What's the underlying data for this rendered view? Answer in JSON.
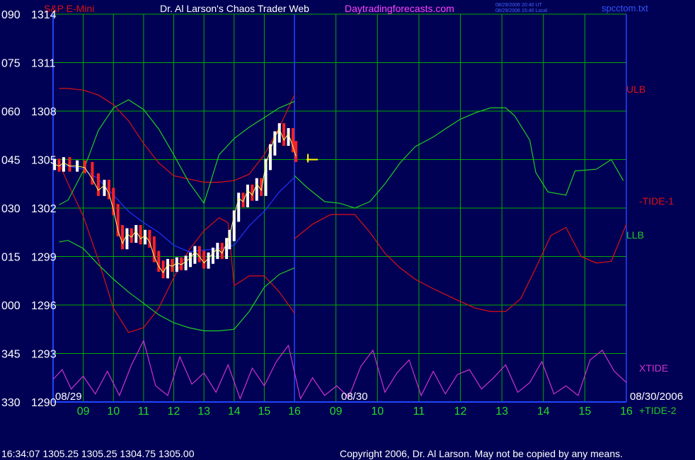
{
  "header": {
    "instrument": "S&P E-Mini",
    "title": "Dr. Al Larson's Chaos Trader Web",
    "site": "Daytradingforecasts.com",
    "stamp_ut": "08/29/2006 20:40 UT",
    "stamp_local": "08/29/2006 15:40 Local",
    "file": "spcctom.txt"
  },
  "footer": {
    "quote": "16:34:07  1305.25 1305.25 1304.75 1305.00",
    "copyright": "Copyright 2006, Dr. Al Larson. May not be copied by any means."
  },
  "colors": {
    "background": "#000055",
    "grid": "#00aa00",
    "axis": "#2244ff",
    "ulb_llb_tide1": "#dd1111",
    "llb_green": "#22cc22",
    "xtide": "#cc33cc",
    "avg_blue": "#2233ff",
    "price_bar_up": "#ffffff",
    "price_bar_down": "#ff2222",
    "title_text": "#ffffff",
    "site_text": "#ff44ff",
    "tick_text": "#22dd22"
  },
  "chart_data": {
    "type": "line",
    "y_left_labels": [
      "090",
      "075",
      "060",
      "045",
      "030",
      "015",
      "000",
      "345",
      "330"
    ],
    "y_right_labels": [
      "1314",
      "1311",
      "1308",
      "1305",
      "1302",
      "1299",
      "1296",
      "1293",
      "1290"
    ],
    "ylim": [
      1290,
      1314
    ],
    "x_tick_labels": [
      "09",
      "10",
      "11",
      "12",
      "13",
      "14",
      "15",
      "16",
      "09",
      "10",
      "11",
      "12",
      "13",
      "14",
      "15",
      "16"
    ],
    "date_labels": [
      "08/29",
      "08/30",
      "08/30/2006"
    ],
    "series_labels": [
      "ULB",
      "-TIDE-1",
      "LLB",
      "XTIDE",
      "+TIDE-2"
    ],
    "series": [
      {
        "key": "red_upper",
        "color": "#dd1111",
        "hours": [
          8.2,
          8.5,
          9,
          9.5,
          10,
          10.5,
          11,
          11.5,
          12,
          12.5,
          13,
          13.5,
          14,
          14.5,
          15,
          15.5,
          16
        ],
        "values": [
          1309.4,
          1309.4,
          1309.3,
          1309.0,
          1308.4,
          1307.4,
          1306.0,
          1304.8,
          1304.0,
          1303.8,
          1303.6,
          1303.6,
          1303.7,
          1304.1,
          1305.3,
          1307.0,
          1309.0
        ]
      },
      {
        "key": "red_lower",
        "color": "#dd1111",
        "hours": [
          8.2,
          8.5,
          9,
          9.5,
          10,
          10.5,
          11,
          11.5,
          12,
          12.5,
          13,
          13.5,
          13.8,
          14,
          14.5,
          15,
          15.5,
          16
        ],
        "values": [
          1304.8,
          1303.5,
          1301.5,
          1298.8,
          1295.8,
          1294.3,
          1294.6,
          1295.8,
          1297.7,
          1299.4,
          1300.6,
          1301.4,
          1301.1,
          1297.2,
          1297.8,
          1297.8,
          1296.8,
          1295.5
        ]
      },
      {
        "key": "green_upper",
        "color": "#22cc22",
        "hours": [
          8.2,
          8.5,
          9,
          9.5,
          10,
          10.5,
          11,
          11.5,
          12,
          12.5,
          13,
          13.5,
          14,
          14.5,
          15,
          15.5,
          16
        ],
        "values": [
          1302.2,
          1302.5,
          1304.3,
          1306.8,
          1308.2,
          1308.7,
          1308.1,
          1306.9,
          1305.3,
          1303.6,
          1302.3,
          1305.3,
          1306.3,
          1307.0,
          1307.6,
          1308.2,
          1308.6
        ]
      },
      {
        "key": "green_lower",
        "color": "#22cc22",
        "hours": [
          8.2,
          8.5,
          9,
          9.5,
          10,
          10.5,
          11,
          11.5,
          12,
          12.5,
          13,
          13.5,
          14,
          14.5,
          15,
          15.5,
          16
        ],
        "values": [
          1299.9,
          1300.0,
          1299.5,
          1298.5,
          1297.6,
          1296.8,
          1296.1,
          1295.4,
          1294.9,
          1294.6,
          1294.4,
          1294.4,
          1294.5,
          1295.6,
          1297.1,
          1297.9,
          1298.3
        ]
      },
      {
        "key": "blue_avg",
        "color": "#2233ff",
        "hours": [
          8.2,
          8.5,
          9,
          9.5,
          10,
          10.5,
          11,
          11.5,
          12,
          12.5,
          13,
          13.5,
          14,
          14.5,
          15,
          15.5,
          16
        ],
        "values": [
          1304.6,
          1304.6,
          1304.4,
          1303.8,
          1302.8,
          1301.8,
          1301.1,
          1300.5,
          1299.7,
          1299.3,
          1299.4,
          1299.5,
          1299.7,
          1300.9,
          1301.8,
          1303.0,
          1303.9
        ]
      },
      {
        "key": "tide1_forecast",
        "color": "#dd1111",
        "hours": [
          16,
          16.6,
          17.2,
          18,
          18.5,
          19,
          19.5,
          20,
          20.5,
          21.4,
          22,
          22.5,
          23,
          23.5,
          24,
          24.5,
          25,
          25.5,
          26,
          26.5,
          27
        ],
        "values": [
          1300.1,
          1301.0,
          1301.6,
          1301.6,
          1300.5,
          1299.2,
          1298.3,
          1297.6,
          1297.1,
          1296.3,
          1295.8,
          1295.6,
          1295.6,
          1296.4,
          1298.3,
          1300.3,
          1300.8,
          1299.0,
          1298.6,
          1298.7,
          1301.0
        ]
      },
      {
        "key": "tide2_forecast",
        "color": "#22cc22",
        "hours": [
          16,
          16.4,
          17,
          17.5,
          18,
          18.5,
          19,
          19.5,
          20,
          20.6,
          21,
          21.5,
          22,
          22.5,
          23,
          23.3,
          23.8,
          24,
          24.4,
          25,
          25.3,
          26,
          26.5,
          26.9
        ],
        "values": [
          1304.0,
          1303.3,
          1302.4,
          1302.3,
          1302.0,
          1302.4,
          1303.5,
          1304.8,
          1305.8,
          1306.4,
          1306.9,
          1307.5,
          1307.9,
          1308.2,
          1308.2,
          1307.7,
          1306.2,
          1304.2,
          1303.0,
          1302.8,
          1304.3,
          1304.4,
          1305.0,
          1303.7
        ]
      },
      {
        "key": "xtide",
        "color": "#cc33cc",
        "hours": [
          8,
          8.3,
          8.6,
          9.0,
          9.4,
          9.8,
          10.2,
          10.6,
          11.0,
          11.4,
          11.8,
          12.2,
          12.6,
          13.0,
          13.4,
          13.8,
          14.2,
          14.6,
          15.0,
          15.4,
          15.8,
          16.2,
          16.6,
          17.0,
          17.4,
          17.8,
          18.2,
          18.6,
          19.0,
          19.4,
          19.8,
          20.2,
          20.6,
          21.0,
          21.4,
          21.8,
          22.2,
          22.6,
          23.0,
          23.4,
          23.8,
          24.2,
          24.6,
          25.0,
          25.4,
          25.8,
          26.2,
          26.6,
          27.0
        ],
        "values": [
          1291.4,
          1292.0,
          1290.8,
          1291.6,
          1290.5,
          1291.9,
          1290.4,
          1292.3,
          1293.8,
          1291.0,
          1290.4,
          1292.8,
          1291.1,
          1291.8,
          1290.6,
          1292.3,
          1290.2,
          1292.1,
          1291.0,
          1292.5,
          1293.5,
          1290.2,
          1291.5,
          1290.4,
          1291.0,
          1290.3,
          1292.2,
          1293.2,
          1290.6,
          1291.8,
          1292.6,
          1290.4,
          1291.9,
          1290.5,
          1291.7,
          1292.0,
          1290.8,
          1291.5,
          1292.3,
          1290.6,
          1291.2,
          1292.5,
          1290.5,
          1291.0,
          1290.4,
          1292.6,
          1293.2,
          1291.9,
          1291.2
        ]
      }
    ],
    "price_bars": {
      "hours": [
        8.05,
        8.2,
        8.35,
        8.55,
        8.8,
        9.05,
        9.3,
        9.5,
        9.7,
        9.85,
        10.0,
        10.15,
        10.3,
        10.45,
        10.6,
        10.75,
        10.9,
        11.05,
        11.2,
        11.35,
        11.5,
        11.65,
        11.8,
        11.95,
        12.1,
        12.25,
        12.4,
        12.55,
        12.7,
        12.85,
        13.0,
        13.15,
        13.3,
        13.45,
        13.6,
        13.75,
        13.85,
        14.0,
        14.15,
        14.3,
        14.45,
        14.6,
        14.75,
        14.9,
        15.05,
        15.2,
        15.35,
        15.5,
        15.65,
        15.8,
        15.95,
        16.05
      ],
      "close": [
        1304.7,
        1304.6,
        1304.8,
        1304.6,
        1304.6,
        1304.5,
        1303.8,
        1303.1,
        1303.4,
        1302.9,
        1301.9,
        1300.6,
        1299.8,
        1300.4,
        1300.2,
        1300.6,
        1300.1,
        1300.3,
        1299.9,
        1299.0,
        1298.4,
        1298.0,
        1298.5,
        1298.4,
        1298.6,
        1298.5,
        1298.7,
        1298.9,
        1299.3,
        1299.0,
        1298.6,
        1298.9,
        1299.2,
        1299.5,
        1299.2,
        1299.8,
        1300.3,
        1301.5,
        1302.6,
        1302.4,
        1303.1,
        1302.8,
        1303.5,
        1303.1,
        1304.7,
        1305.6,
        1306.4,
        1306.9,
        1306.2,
        1306.6,
        1305.8,
        1305.2
      ]
    },
    "forecast_marker": {
      "hour": 16.4,
      "value": 1305.0
    }
  }
}
